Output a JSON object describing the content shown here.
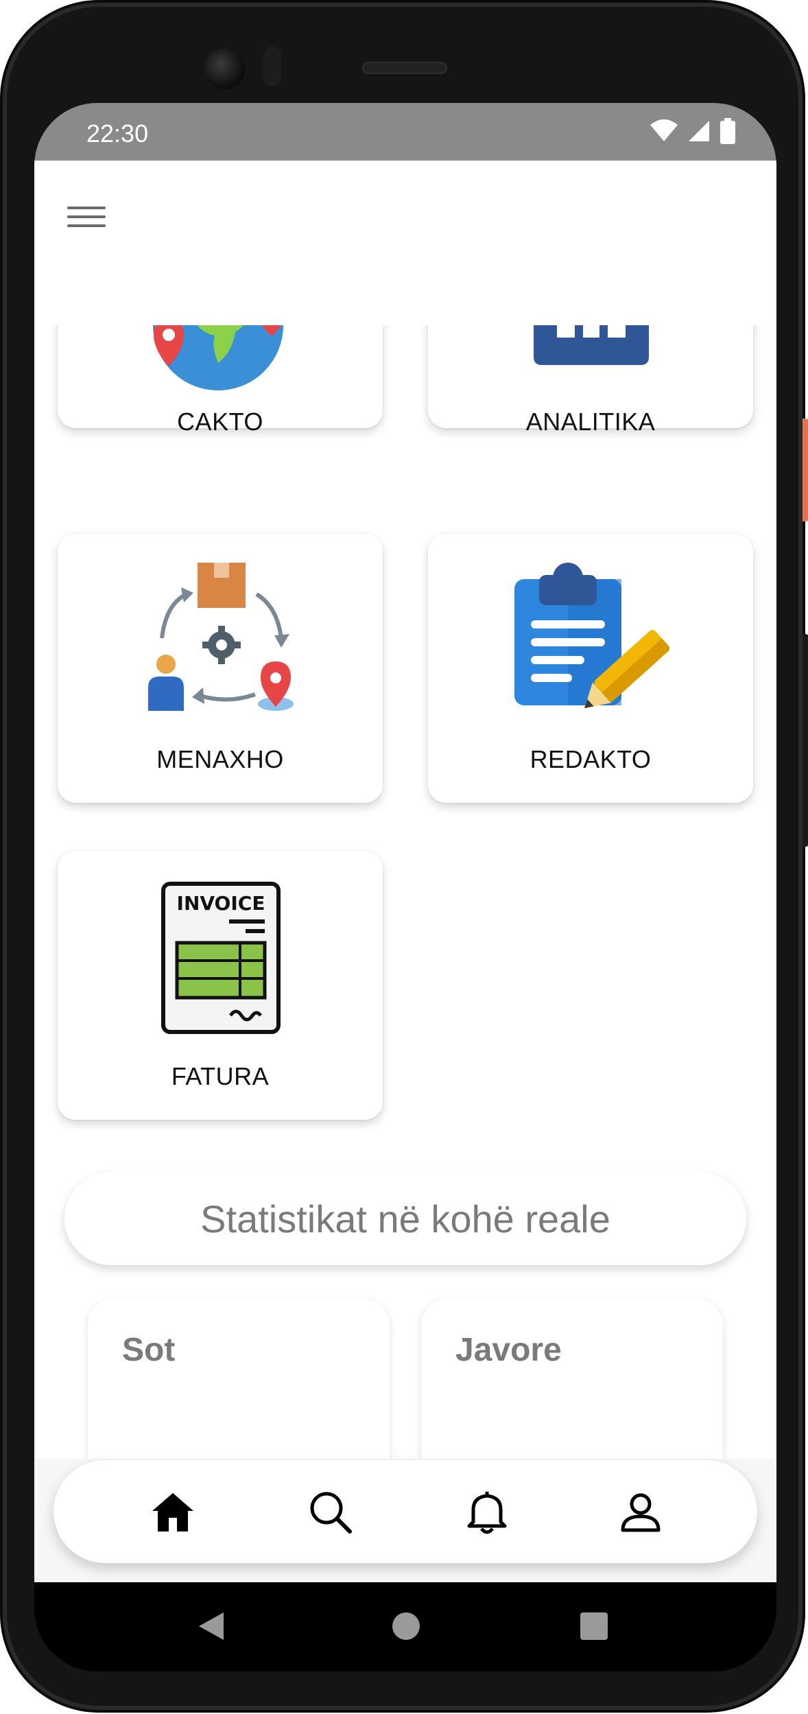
{
  "status_bar": {
    "time": "22:30",
    "icons": [
      "wifi-icon",
      "cell-signal-icon",
      "battery-icon"
    ]
  },
  "app_bar": {
    "menu_icon": "hamburger-menu-icon"
  },
  "tiles": [
    {
      "label": "CAKTO",
      "icon": "globe-location-icon"
    },
    {
      "label": "ANALITIKA",
      "icon": "bar-chart-icon"
    },
    {
      "label": "MENAXHO",
      "icon": "logistics-cycle-icon"
    },
    {
      "label": "REDAKTO",
      "icon": "clipboard-edit-icon"
    },
    {
      "label": "FATURA",
      "icon": "invoice-icon",
      "icon_text": "INVOICE"
    }
  ],
  "stats": {
    "heading": "Statistikat në kohë reale",
    "cards": [
      {
        "title": "Sot"
      },
      {
        "title": "Javore"
      }
    ]
  },
  "bottom_nav": [
    "home-icon",
    "search-icon",
    "bell-icon",
    "user-icon"
  ],
  "system_nav": [
    "back-icon",
    "home-circle-icon",
    "recents-icon"
  ],
  "colors": {
    "status_bar": "#8a8a8a",
    "card_bg": "#ffffff",
    "muted_text": "#7a7a7a",
    "accent_orange": "#e6734f"
  }
}
